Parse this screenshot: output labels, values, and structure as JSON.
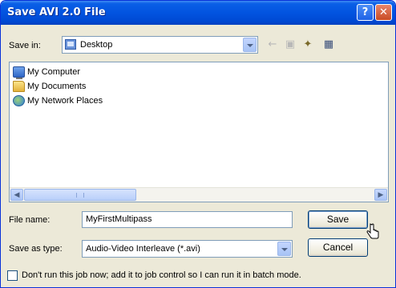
{
  "window": {
    "title": "Save AVI 2.0 File",
    "help_glyph": "?",
    "close_glyph": "✕"
  },
  "save_in": {
    "label": "Save in:",
    "value": "Desktop"
  },
  "toolbar": {
    "back_glyph": "←",
    "up_glyph": "▣",
    "new_folder_glyph": "✦",
    "view_menu_glyph": "▦"
  },
  "file_list": {
    "items": [
      {
        "name": "My Computer",
        "icon": "computer-icon"
      },
      {
        "name": "My Documents",
        "icon": "documents-folder-icon"
      },
      {
        "name": "My Network Places",
        "icon": "network-places-icon"
      }
    ],
    "scroll_left": "◀",
    "scroll_right": "▶"
  },
  "file_name": {
    "label": "File name:",
    "value": "MyFirstMultipass"
  },
  "save_as_type": {
    "label": "Save as type:",
    "value": "Audio-Video Interleave (*.avi)"
  },
  "buttons": {
    "save": "Save",
    "cancel": "Cancel"
  },
  "batch": {
    "checked": false,
    "label": "Don't run this job now; add it to job control so I can run it in batch mode."
  },
  "colors": {
    "title_bar": "#0254e0",
    "dialog_bg": "#ece9d8",
    "close_button": "#c94b24",
    "field_border": "#7f9db9"
  }
}
